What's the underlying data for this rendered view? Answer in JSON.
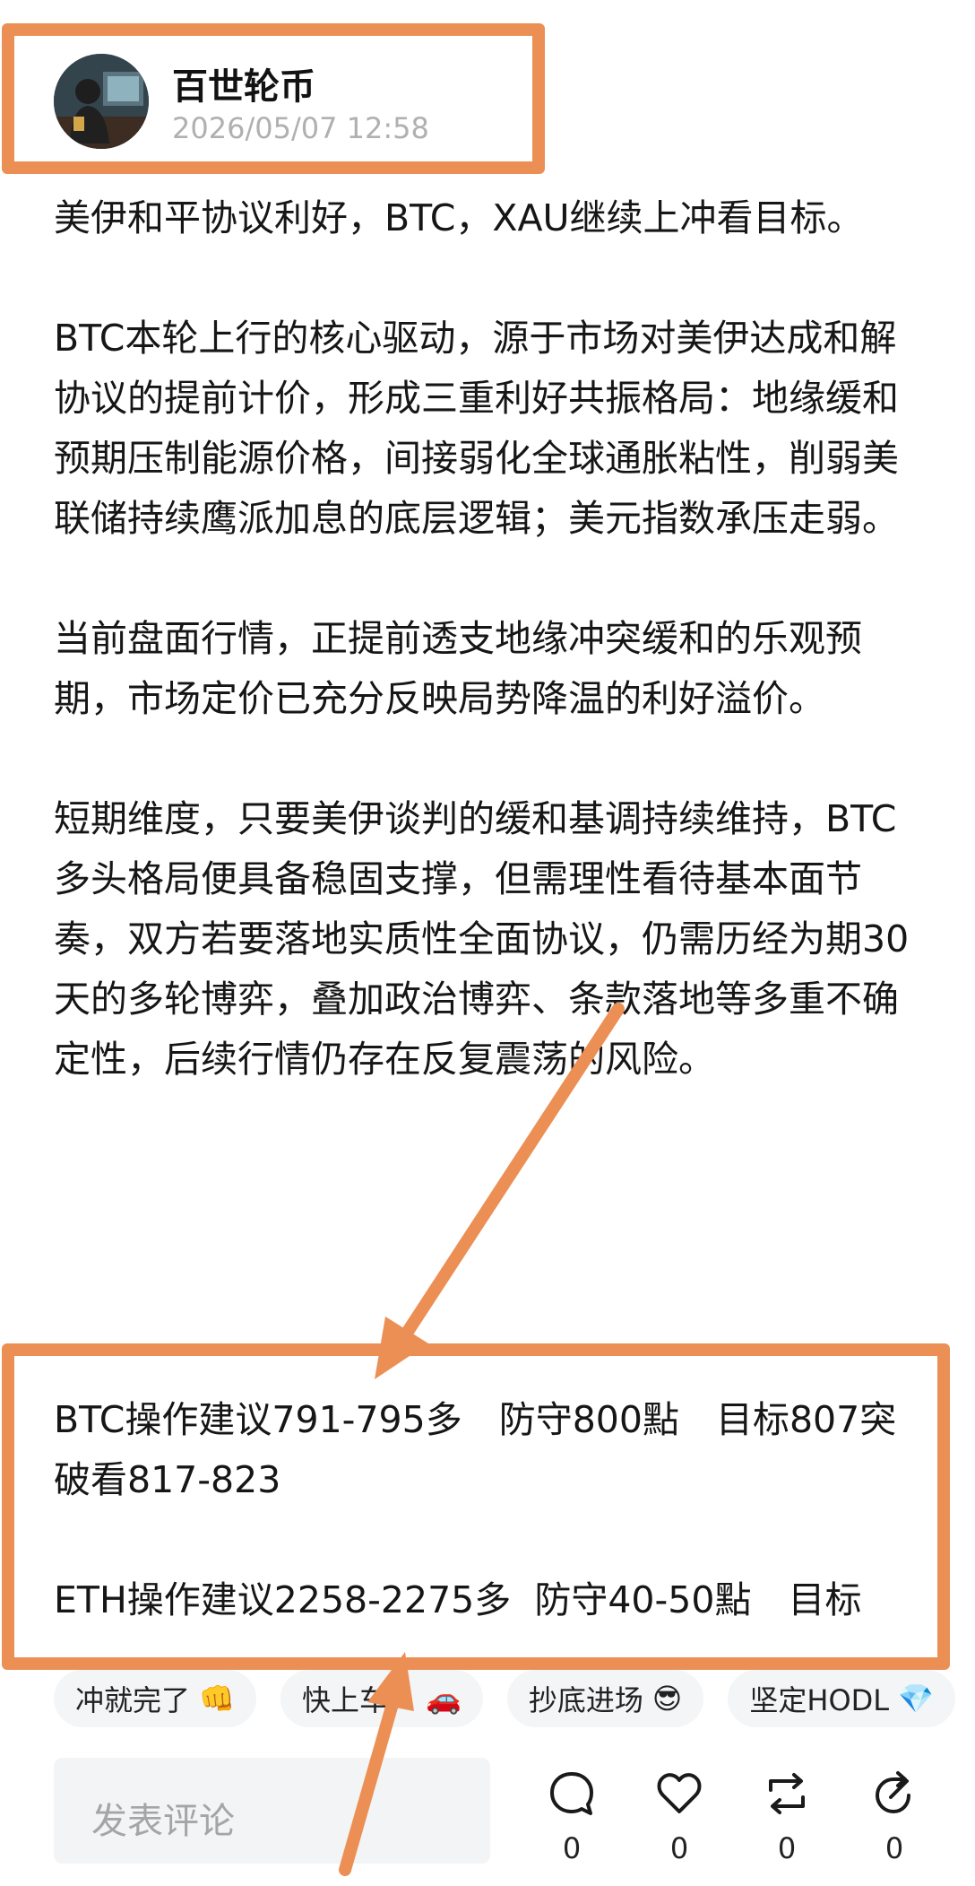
{
  "author": {
    "name": "百世轮币",
    "timestamp": "2026/05/07 12:58"
  },
  "post": {
    "paragraphs": [
      "美伊和平协议利好，BTC，XAU继续上冲看目标。",
      "BTC本轮上行的核心驱动，源于市场对美伊达成和解协议的提前计价，形成三重利好共振格局：地缘缓和预期压制能源价格，间接弱化全球通胀粘性，削弱美联储持续鹰派加息的底层逻辑；美元指数承压走弱。",
      "当前盘面行情，正提前透支地缘冲突缓和的乐观预期，市场定价已充分反映局势降温的利好溢价。",
      "短期维度，只要美伊谈判的缓和基调持续维持，BTC多头格局便具备稳固支撑，但需理性看待基本面节奏，双方若要落地实质性全面协议，仍需历经为期30天的多轮博弈，叠加政治博弈、条款落地等多重不确定性，后续行情仍存在反复震荡的风险。"
    ],
    "operations": [
      "BTC操作建议791-795多　防守800點　目标807突破看817-823",
      "ETH操作建议2258-2275多  防守40-50點　目标"
    ]
  },
  "chips": [
    {
      "label": "冲就完了",
      "emoji": "👊"
    },
    {
      "label": "快上车！",
      "emoji": "🚗"
    },
    {
      "label": "抄底进场",
      "emoji": "😎"
    },
    {
      "label": "坚定HODL",
      "emoji": "💎"
    }
  ],
  "comment": {
    "placeholder": "发表评论"
  },
  "actions": {
    "comment_count": "0",
    "like_count": "0",
    "repost_count": "0",
    "share_count": "0"
  },
  "colors": {
    "highlight": "#ec8f55",
    "timestamp": "#b0b0b0",
    "chip_bg": "#f4f5f7"
  },
  "icons": [
    "comment-icon",
    "heart-icon",
    "repost-icon",
    "share-icon"
  ]
}
